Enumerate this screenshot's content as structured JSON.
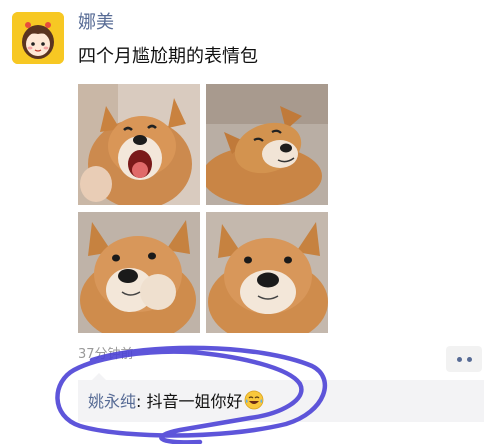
{
  "post": {
    "author": "娜美",
    "text": "四个月尴尬期的表情包",
    "time": "37分钟前",
    "more_icon": "ellipsis-icon",
    "photos": [
      {
        "name": "shiba-laughing-photo"
      },
      {
        "name": "shiba-lying-photo"
      },
      {
        "name": "shiba-face-photo-1"
      },
      {
        "name": "shiba-face-photo-2"
      }
    ]
  },
  "comments": [
    {
      "name": "姚永纯",
      "separator": ": ",
      "text": "抖音一姐你好",
      "emoji": "laughing-tears-emoji"
    }
  ],
  "colors": {
    "link": "#576b95",
    "annotation_stroke": "#4c42d6",
    "avatar_bg": "#f7c823"
  }
}
